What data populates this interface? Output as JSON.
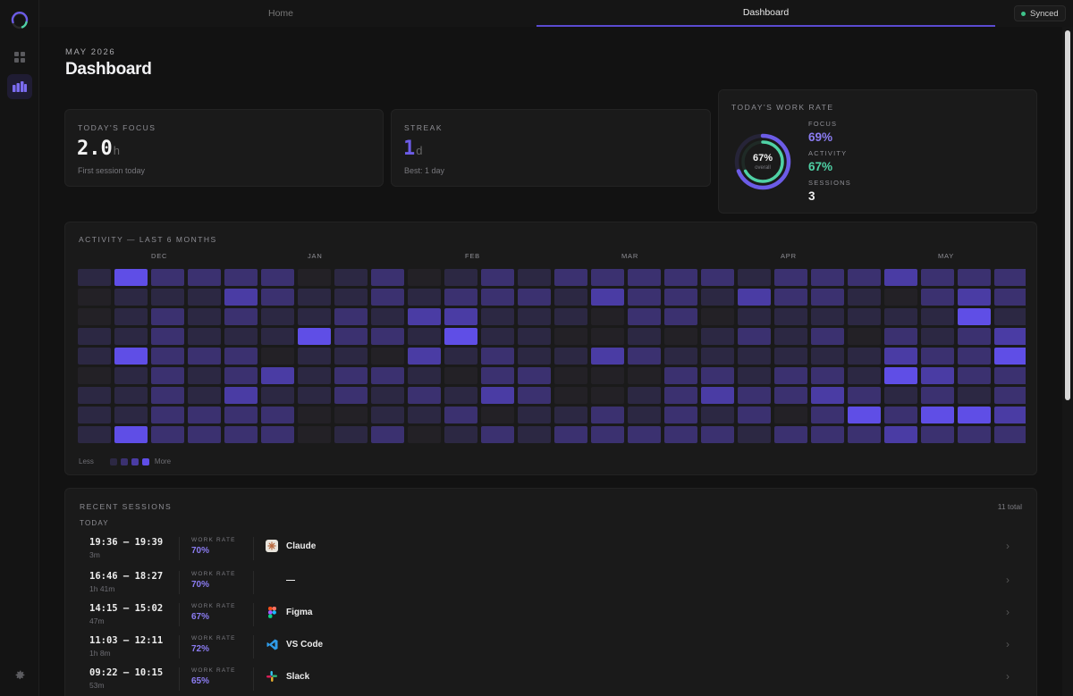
{
  "nav": {
    "tabs": [
      "Home",
      "Dashboard"
    ],
    "active_tab": "Dashboard",
    "sync_status": "Synced"
  },
  "header": {
    "eyebrow": "MAY 2026",
    "title": "Dashboard"
  },
  "focus": {
    "label": "TODAY'S FOCUS",
    "value": "2.0",
    "unit": "h",
    "sub": "First session today"
  },
  "streak": {
    "label": "STREAK",
    "value": "1",
    "unit": "d",
    "sub": "Best: 1 day"
  },
  "work_rate": {
    "label": "TODAY'S WORK RATE",
    "overall_pct": "67%",
    "overall_label": "overall",
    "overall_value": 67,
    "focus_value": 69,
    "metrics": [
      {
        "label": "FOCUS",
        "value": "69%",
        "color": "#8b7cf2"
      },
      {
        "label": "ACTIVITY",
        "value": "67%",
        "color": "#4fd1a5"
      },
      {
        "label": "SESSIONS",
        "value": "3",
        "color": "#f0f0f0"
      }
    ]
  },
  "activity": {
    "label": "ACTIVITY — LAST 6 MONTHS",
    "months": [
      "DEC",
      "JAN",
      "FEB",
      "MAR",
      "APR",
      "MAY"
    ],
    "legend_less": "Less",
    "legend_more": "More",
    "colors": [
      "#232126",
      "#2c2843",
      "#3b3170",
      "#4a3ca4",
      "#5f4ee6"
    ],
    "levels": [
      [
        1,
        0,
        0,
        1,
        1,
        0,
        1,
        1
      ],
      [
        4,
        1,
        1,
        1,
        4,
        1,
        1,
        1
      ],
      [
        2,
        1,
        2,
        2,
        2,
        2,
        2,
        2
      ],
      [
        2,
        1,
        1,
        1,
        2,
        1,
        1,
        2
      ],
      [
        2,
        3,
        2,
        1,
        2,
        2,
        3,
        2
      ],
      [
        2,
        2,
        1,
        1,
        0,
        3,
        1,
        2
      ],
      [
        0,
        1,
        1,
        4,
        1,
        1,
        1,
        0
      ],
      [
        1,
        1,
        2,
        2,
        1,
        2,
        2,
        0
      ],
      [
        2,
        2,
        1,
        2,
        0,
        2,
        1,
        1
      ],
      [
        0,
        1,
        3,
        1,
        3,
        1,
        2,
        1
      ],
      [
        1,
        2,
        3,
        4,
        1,
        0,
        1,
        2
      ],
      [
        2,
        2,
        1,
        1,
        2,
        2,
        3,
        0
      ],
      [
        1,
        2,
        1,
        1,
        1,
        2,
        2,
        1
      ],
      [
        2,
        1,
        1,
        0,
        1,
        0,
        0,
        1
      ],
      [
        2,
        3,
        0,
        0,
        3,
        0,
        0,
        2
      ],
      [
        2,
        2,
        2,
        1,
        2,
        0,
        1,
        1
      ],
      [
        2,
        2,
        2,
        0,
        1,
        2,
        2,
        2
      ],
      [
        2,
        1,
        0,
        1,
        1,
        2,
        3,
        1
      ],
      [
        1,
        3,
        1,
        2,
        1,
        1,
        2,
        2
      ],
      [
        2,
        2,
        1,
        1,
        1,
        2,
        2,
        0
      ],
      [
        2,
        2,
        1,
        2,
        1,
        2,
        3,
        2
      ],
      [
        2,
        1,
        1,
        0,
        1,
        1,
        2,
        4
      ],
      [
        3,
        0,
        1,
        2,
        3,
        4,
        1,
        2
      ],
      [
        2,
        2,
        1,
        1,
        2,
        3,
        2,
        4
      ],
      [
        2,
        3,
        4,
        2,
        2,
        2,
        1,
        4
      ],
      [
        2,
        2,
        1,
        3,
        4,
        2,
        2,
        3
      ],
      [
        0,
        3,
        2,
        1,
        1,
        2,
        4,
        2
      ],
      [
        3,
        3,
        3,
        2,
        1,
        3,
        3,
        3
      ],
      [
        4,
        2,
        2,
        1,
        2,
        4,
        1,
        4
      ],
      [
        1,
        1,
        2,
        3,
        4,
        0,
        4,
        2
      ],
      [
        0,
        3,
        4,
        3,
        2,
        3,
        3,
        2
      ],
      [
        1,
        3,
        2,
        3,
        1,
        3,
        2,
        2
      ],
      [
        0,
        3,
        2,
        3,
        4,
        4,
        2,
        1
      ],
      [
        1,
        2,
        2,
        0,
        1,
        1,
        1,
        1
      ],
      [
        1,
        2,
        3,
        2,
        1,
        1,
        4,
        3
      ],
      [
        1,
        2,
        4,
        2,
        2,
        3,
        1,
        4
      ],
      [
        1,
        3,
        1,
        0,
        0,
        1,
        1,
        3
      ],
      [
        2,
        3,
        2,
        1,
        2,
        2,
        2,
        2
      ],
      [
        0,
        2,
        4,
        3,
        3,
        2,
        2,
        2
      ],
      [
        0,
        0,
        2,
        4,
        2,
        2,
        0,
        4
      ],
      [
        4,
        3,
        1,
        2,
        3,
        2,
        2,
        1
      ],
      [
        2,
        1,
        4,
        2,
        4,
        1,
        3,
        0
      ],
      [
        2,
        1,
        3,
        3,
        2,
        2,
        2,
        1
      ],
      [
        3,
        1,
        3,
        4,
        2,
        3,
        2,
        2
      ],
      [
        1,
        1,
        1,
        1,
        2,
        1,
        3,
        4
      ],
      [
        1,
        2,
        2,
        2,
        2,
        0,
        3,
        2
      ],
      [
        2,
        3,
        3,
        2,
        2,
        3,
        4,
        3
      ],
      [
        3,
        3,
        3,
        2,
        2,
        3,
        2,
        3
      ],
      [
        1,
        1,
        2,
        1,
        1,
        2,
        2,
        1
      ],
      [
        4,
        3,
        0,
        3,
        3,
        0,
        2,
        4
      ],
      [
        1,
        2,
        2,
        2,
        3,
        2,
        2,
        2
      ],
      [
        3,
        0,
        1,
        0,
        1,
        1,
        2,
        0
      ],
      [
        2,
        2,
        1,
        1,
        3,
        3,
        2,
        4
      ],
      [
        0,
        2,
        2,
        2,
        2,
        3,
        2,
        3
      ],
      [
        2,
        3,
        0,
        0,
        3,
        3,
        3,
        0
      ],
      [
        2,
        2,
        3,
        1,
        4,
        3,
        3,
        0
      ],
      [
        3,
        3,
        1,
        3,
        1,
        1,
        2,
        3
      ],
      [
        2,
        2,
        2,
        1,
        3,
        3,
        2,
        2
      ],
      [
        2,
        3,
        4,
        2,
        3,
        3,
        3,
        2
      ],
      [
        2,
        3,
        3,
        3,
        1,
        2,
        1,
        0
      ],
      [
        2,
        3,
        1,
        3,
        3,
        3,
        2,
        4
      ],
      [
        4,
        4,
        3,
        2,
        3,
        4,
        3,
        3
      ],
      [
        2,
        2,
        1,
        3,
        3,
        4,
        2,
        2
      ],
      [
        1,
        2,
        2,
        4,
        3,
        4,
        1,
        4
      ],
      [
        2,
        3,
        3,
        3,
        4,
        2,
        1,
        3
      ],
      [
        2,
        3,
        3,
        4,
        2,
        4,
        3,
        2
      ],
      [
        4,
        2,
        3,
        1,
        1,
        3,
        4,
        2
      ],
      [
        3,
        3,
        2,
        4,
        4,
        3,
        2,
        4
      ],
      [
        3,
        4,
        4,
        3,
        4,
        4,
        3,
        4
      ],
      [
        3,
        3,
        2,
        4,
        3,
        4,
        4,
        4
      ],
      [
        4,
        1,
        2,
        2,
        2,
        3,
        3,
        4
      ],
      [
        3,
        3,
        3,
        3,
        2,
        3,
        3,
        4
      ],
      [
        4,
        2,
        3,
        3,
        3,
        3,
        3,
        1
      ],
      [
        4,
        3,
        3,
        4,
        2,
        3,
        4,
        4
      ],
      [
        3,
        4,
        3,
        2,
        3,
        3,
        3,
        3
      ],
      [
        3,
        2,
        3,
        4,
        3,
        3,
        2,
        2
      ],
      [
        4,
        4,
        4,
        3,
        4,
        4,
        3,
        4
      ],
      [
        3,
        3,
        4,
        3,
        3,
        4,
        4,
        3
      ],
      [
        3,
        3,
        3,
        2,
        3,
        3,
        3,
        4
      ],
      [
        2,
        3,
        4,
        3,
        4,
        3,
        3,
        2
      ],
      [
        4,
        4,
        3,
        4,
        4,
        3,
        3,
        4
      ],
      [
        3,
        4,
        4,
        3,
        3,
        3,
        4,
        3
      ],
      [
        4,
        4,
        4,
        4,
        3,
        4,
        3,
        4
      ],
      [
        3,
        3,
        3,
        3,
        4,
        4,
        3,
        4
      ],
      [
        4,
        4,
        4,
        3,
        4,
        4,
        4,
        4
      ],
      [
        3,
        3,
        3,
        4,
        3,
        3,
        4,
        3
      ],
      [
        3,
        4,
        4,
        4,
        3,
        4,
        4,
        4
      ],
      [
        4,
        3,
        3,
        3,
        4,
        3,
        4,
        3
      ],
      [
        4,
        4,
        4,
        4,
        4,
        4,
        4,
        4
      ],
      [
        3,
        4,
        4,
        3,
        4,
        4,
        4,
        3
      ],
      [
        4,
        4,
        4,
        4,
        3,
        4,
        4,
        4
      ],
      [
        4,
        3,
        4,
        4,
        4,
        3,
        4,
        4
      ],
      [
        4,
        4,
        3,
        4,
        4,
        4,
        3,
        4
      ],
      [
        4,
        4,
        4,
        3,
        4,
        4,
        4,
        4
      ],
      [
        3,
        4,
        4,
        4,
        4,
        4,
        4,
        3
      ],
      [
        4,
        4,
        4,
        4,
        4,
        3,
        4,
        4
      ],
      [
        4,
        3,
        4,
        4,
        3,
        4,
        4,
        4
      ],
      [
        4,
        4,
        4,
        4,
        4,
        4,
        3,
        4
      ],
      [
        3,
        4,
        4,
        4,
        4,
        4,
        4,
        4
      ],
      [
        4,
        4,
        3,
        4,
        4,
        4,
        4,
        3
      ],
      [
        4,
        4,
        4,
        4,
        4,
        4,
        4,
        4
      ],
      [
        4,
        4,
        4,
        4,
        4,
        4,
        4,
        4
      ],
      [
        4,
        4,
        4,
        4,
        4,
        4,
        4,
        4
      ],
      [
        4,
        4,
        4,
        4,
        4,
        4,
        4,
        4
      ],
      [
        4,
        4,
        4,
        4,
        4,
        4,
        4,
        4
      ],
      [
        4,
        4,
        4,
        4,
        4,
        4,
        4,
        4
      ],
      [
        4,
        4,
        4,
        4,
        4,
        4,
        4,
        4
      ],
      [
        4,
        4,
        4,
        4,
        4,
        4,
        4,
        4
      ],
      [
        4,
        4,
        4,
        4,
        4,
        4,
        4,
        4
      ],
      [
        4,
        4,
        4,
        4,
        4,
        4,
        4,
        4
      ],
      [
        4,
        4,
        4,
        4,
        4,
        4,
        4,
        4
      ],
      [
        4,
        4,
        4,
        4,
        4,
        4,
        4,
        4
      ],
      [
        4,
        4,
        4,
        4,
        4,
        4,
        4,
        4
      ],
      [
        4,
        4,
        4,
        4,
        4,
        4,
        4,
        4
      ],
      [
        4,
        4,
        4,
        4,
        4,
        4,
        4,
        4
      ],
      [
        4,
        4,
        4,
        4,
        4,
        4,
        4,
        4
      ],
      [
        4,
        4,
        4,
        4,
        4,
        4,
        4,
        4
      ],
      [
        4,
        4,
        4,
        4,
        4,
        4,
        4,
        4
      ],
      [
        4,
        4,
        4,
        4,
        4,
        4,
        4,
        4
      ],
      [
        4,
        4,
        4,
        4,
        4,
        4,
        4,
        4
      ],
      [
        4,
        4,
        4,
        4,
        4,
        4,
        4,
        4
      ],
      [
        4,
        4,
        4,
        4,
        4,
        4,
        4,
        4
      ],
      [
        4,
        4,
        4,
        4,
        4,
        4,
        4,
        4
      ],
      [
        4,
        4,
        4,
        4,
        4,
        4,
        4,
        4
      ],
      [
        4,
        4,
        4,
        4,
        4,
        4,
        4,
        4
      ],
      [
        4,
        4,
        4,
        4,
        4,
        4,
        4,
        4
      ],
      [
        4,
        4,
        4,
        4,
        4,
        4,
        4,
        4
      ],
      [
        4,
        4,
        4,
        4,
        4,
        4,
        4,
        4
      ],
      [
        4,
        4,
        4,
        4,
        4,
        4,
        4,
        4
      ]
    ]
  },
  "sessions": {
    "label": "RECENT SESSIONS",
    "total": "11 total",
    "day": "TODAY",
    "wr_label": "WORK RATE",
    "items": [
      {
        "time": "19:36 – 19:39",
        "duration": "3m",
        "rate": "70%",
        "app": "Claude",
        "icon": "claude-icon"
      },
      {
        "time": "16:46 – 18:27",
        "duration": "1h 41m",
        "rate": "70%",
        "app": "—",
        "icon": "none"
      },
      {
        "time": "14:15 – 15:02",
        "duration": "47m",
        "rate": "67%",
        "app": "Figma",
        "icon": "figma-icon"
      },
      {
        "time": "11:03 – 12:11",
        "duration": "1h 8m",
        "rate": "72%",
        "app": "VS Code",
        "icon": "vscode-icon"
      },
      {
        "time": "09:22 – 10:15",
        "duration": "53m",
        "rate": "65%",
        "app": "Slack",
        "icon": "slack-icon"
      }
    ]
  }
}
